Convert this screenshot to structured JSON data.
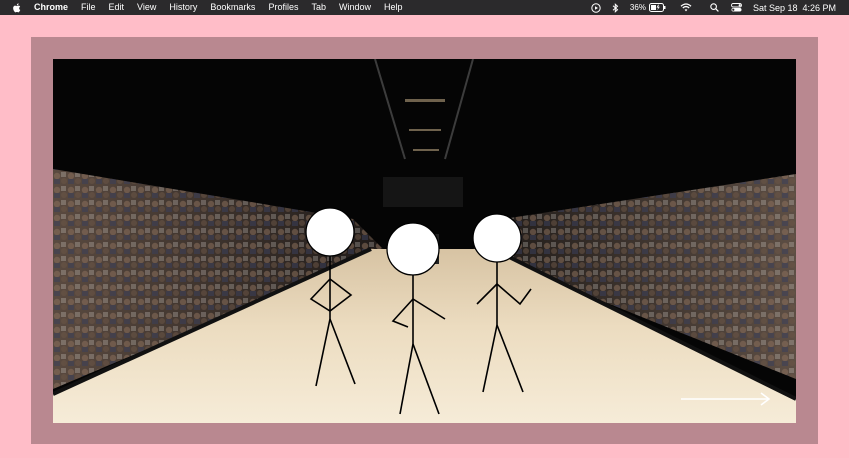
{
  "menubar": {
    "app_name": "Chrome",
    "menus": [
      "File",
      "Edit",
      "View",
      "History",
      "Bookmarks",
      "Profiles",
      "Tab",
      "Window",
      "Help"
    ],
    "battery_percent": "36%",
    "datetime": "Sat Sep 18  4:26 PM",
    "icons": [
      "apple-icon",
      "play-icon",
      "bluetooth-icon",
      "battery-icon",
      "wifi-icon",
      "search-icon",
      "control-center-icon"
    ]
  },
  "canvas": {
    "background_color": "#ffbdc8",
    "frame_color": "#b98890",
    "scene": "runway-photo",
    "figures": [
      "stick-figure-left",
      "stick-figure-middle",
      "stick-figure-right"
    ],
    "next_arrow": "arrow-right-icon"
  }
}
